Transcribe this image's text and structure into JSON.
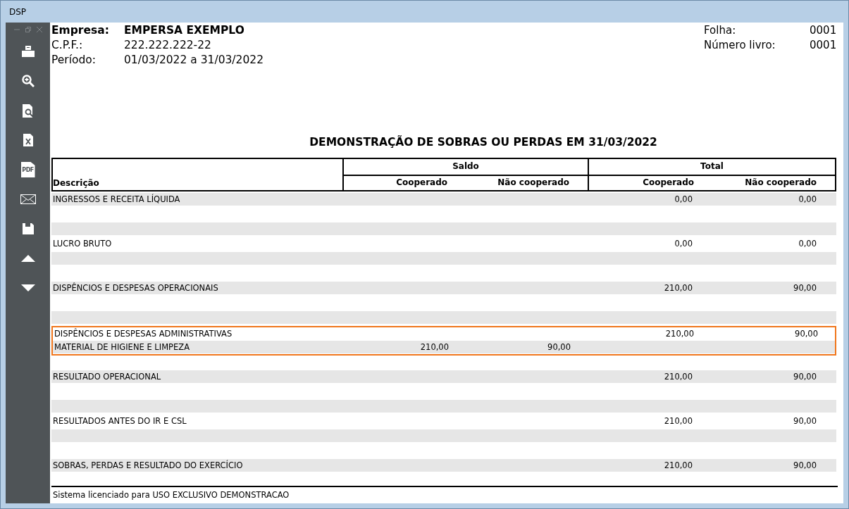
{
  "window": {
    "title": "DSP"
  },
  "toolbar": [
    {
      "kind": "print"
    },
    {
      "kind": "zoom"
    },
    {
      "kind": "preview"
    },
    {
      "kind": "excel"
    },
    {
      "kind": "pdf",
      "label": "PDF"
    },
    {
      "kind": "mail"
    },
    {
      "kind": "save"
    },
    {
      "kind": "up"
    },
    {
      "kind": "down"
    }
  ],
  "header": {
    "left": [
      {
        "label": "Empresa:",
        "value": "EMPERSA EXEMPLO",
        "bold": true
      },
      {
        "label": "C.P.F.:",
        "value": "222.222.222-22",
        "bold": false
      },
      {
        "label": "Período:",
        "value": "01/03/2022 a 31/03/2022",
        "bold": false
      }
    ],
    "right": [
      {
        "label": "Folha:",
        "value": "0001"
      },
      {
        "label": "Número livro:",
        "value": "0001"
      }
    ]
  },
  "report_title": "DEMONSTRAÇÃO DE SOBRAS OU PERDAS EM 31/03/2022",
  "table": {
    "description_heading": "Descrição",
    "groups": [
      {
        "title": "Saldo",
        "columns": [
          "Cooperado",
          "Não cooperado"
        ]
      },
      {
        "title": "Total",
        "columns": [
          "Cooperado",
          "Não cooperado"
        ]
      }
    ],
    "rows": [
      {
        "kind": "line",
        "description": "INGRESSOS E RECEITA LÍQUIDA",
        "total_cooperado": "0,00",
        "total_nao_cooperado": "0,00",
        "selected": false
      },
      {
        "kind": "blank"
      },
      {
        "kind": "blank"
      },
      {
        "kind": "line",
        "description": "LUCRO BRUTO",
        "total_cooperado": "0,00",
        "total_nao_cooperado": "0,00",
        "selected": false
      },
      {
        "kind": "blank"
      },
      {
        "kind": "blank"
      },
      {
        "kind": "line",
        "description": "DISPÊNCIOS E DESPESAS OPERACIONAIS",
        "total_cooperado": "210,00",
        "total_nao_cooperado": "90,00",
        "selected": false
      },
      {
        "kind": "blank"
      },
      {
        "kind": "blank"
      },
      {
        "kind": "line",
        "description": "DISPÊNCIOS E DESPESAS ADMINISTRATIVAS",
        "total_cooperado": "210,00",
        "total_nao_cooperado": "90,00",
        "selected": true
      },
      {
        "kind": "line",
        "description": "MATERIAL DE HIGIENE E LIMPEZA",
        "saldo_cooperado": "210,00",
        "saldo_nao_cooperado": "90,00",
        "selected": true
      },
      {
        "kind": "blank"
      },
      {
        "kind": "line",
        "description": "RESULTADO OPERACIONAL",
        "total_cooperado": "210,00",
        "total_nao_cooperado": "90,00",
        "selected": false
      },
      {
        "kind": "blank"
      },
      {
        "kind": "blank"
      },
      {
        "kind": "line",
        "description": "RESULTADOS ANTES DO IR E CSL",
        "total_cooperado": "210,00",
        "total_nao_cooperado": "90,00",
        "selected": false
      },
      {
        "kind": "blank"
      },
      {
        "kind": "blank"
      },
      {
        "kind": "line",
        "description": "SOBRAS, PERDAS E RESULTADO DO EXERCÍCIO",
        "total_cooperado": "210,00",
        "total_nao_cooperado": "90,00",
        "selected": false
      }
    ]
  },
  "footer": "Sistema licenciado para USO EXCLUSIVO DEMONSTRACAO"
}
